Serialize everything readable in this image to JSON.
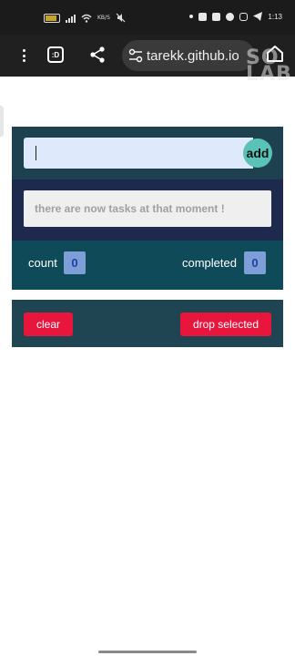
{
  "status_bar": {
    "clock": "1:13",
    "network_speed": "KB/S",
    "icons": [
      "battery-icon",
      "signal-icon",
      "wifi-icon",
      "mute-icon",
      "linkedin-icon",
      "youtube-icon",
      "chat-icon",
      "instagram-icon",
      "telegram-icon"
    ]
  },
  "browser": {
    "tabs_label": ":D",
    "url": "tarekk.github.io",
    "watermark": "SO\nLAB"
  },
  "app": {
    "input": {
      "value": "",
      "placeholder": ""
    },
    "add_label": "add",
    "empty_message": "there are now tasks at that moment !",
    "count_label": "count",
    "count_value": "0",
    "completed_label": "completed",
    "completed_value": "0",
    "clear_label": "clear",
    "drop_label": "drop selected"
  },
  "colors": {
    "input_section": "#1e4150",
    "tasks_section": "#1d2a4e",
    "stats_section": "#0f4a58",
    "actions_section": "#1f4553",
    "add_button": "#5ac3b8",
    "danger_button": "#e8163d",
    "badge": "#7e9ed8"
  }
}
